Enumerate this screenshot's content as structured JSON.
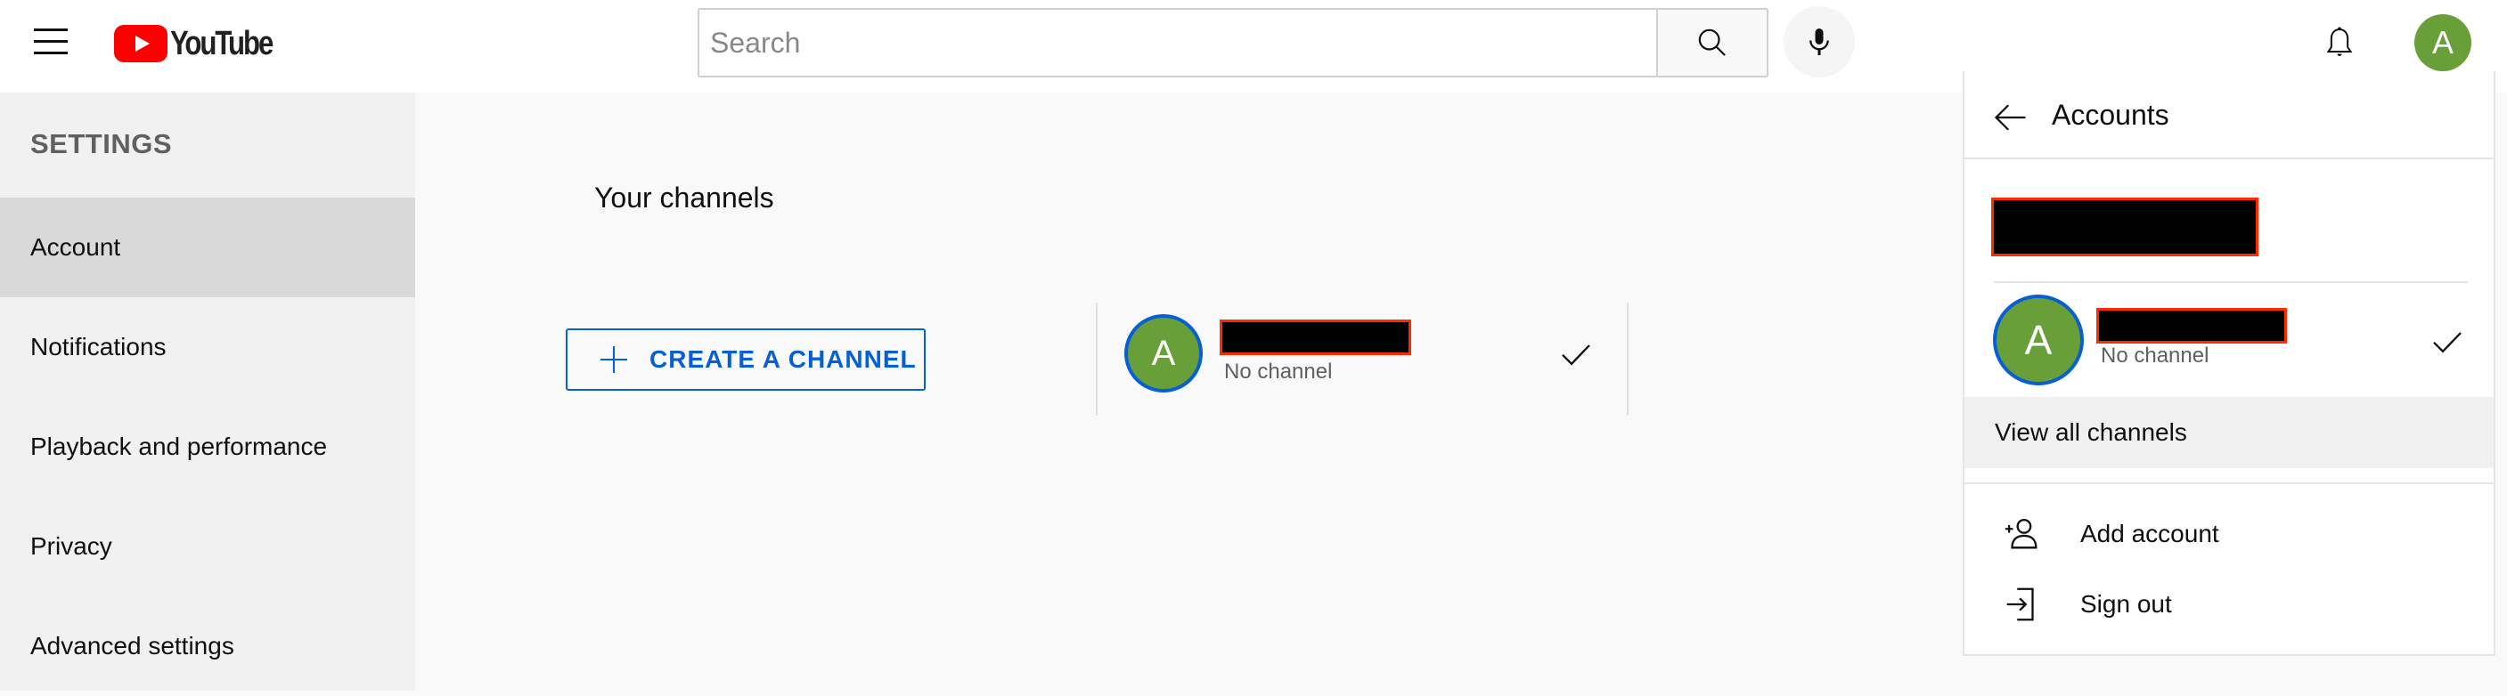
{
  "header": {
    "logo_text": "YouTube",
    "search_placeholder": "Search",
    "search_value": "",
    "avatar_initial": "A"
  },
  "sidebar": {
    "title": "SETTINGS",
    "items": [
      {
        "label": "Account",
        "active": true
      },
      {
        "label": "Notifications",
        "active": false
      },
      {
        "label": "Playback and performance",
        "active": false
      },
      {
        "label": "Privacy",
        "active": false
      },
      {
        "label": "Advanced settings",
        "active": false
      }
    ]
  },
  "main": {
    "section_title": "Your channels",
    "create_channel_label": "CREATE A CHANNEL",
    "channel": {
      "avatar_initial": "A",
      "name": "[redacted]",
      "subtitle": "No channel",
      "selected": true
    }
  },
  "accounts_panel": {
    "title": "Accounts",
    "account_email": "[redacted]",
    "channel": {
      "avatar_initial": "A",
      "name": "[redacted]",
      "subtitle": "No channel",
      "selected": true
    },
    "view_all_label": "View all channels",
    "menu": [
      {
        "icon": "add-person-icon",
        "label": "Add account"
      },
      {
        "icon": "sign-out-icon",
        "label": "Sign out"
      }
    ]
  },
  "colors": {
    "brand_red": "#ff0000",
    "accent_blue": "#065fd4",
    "avatar_green": "#689f38",
    "redaction_border": "#ff2a00"
  }
}
